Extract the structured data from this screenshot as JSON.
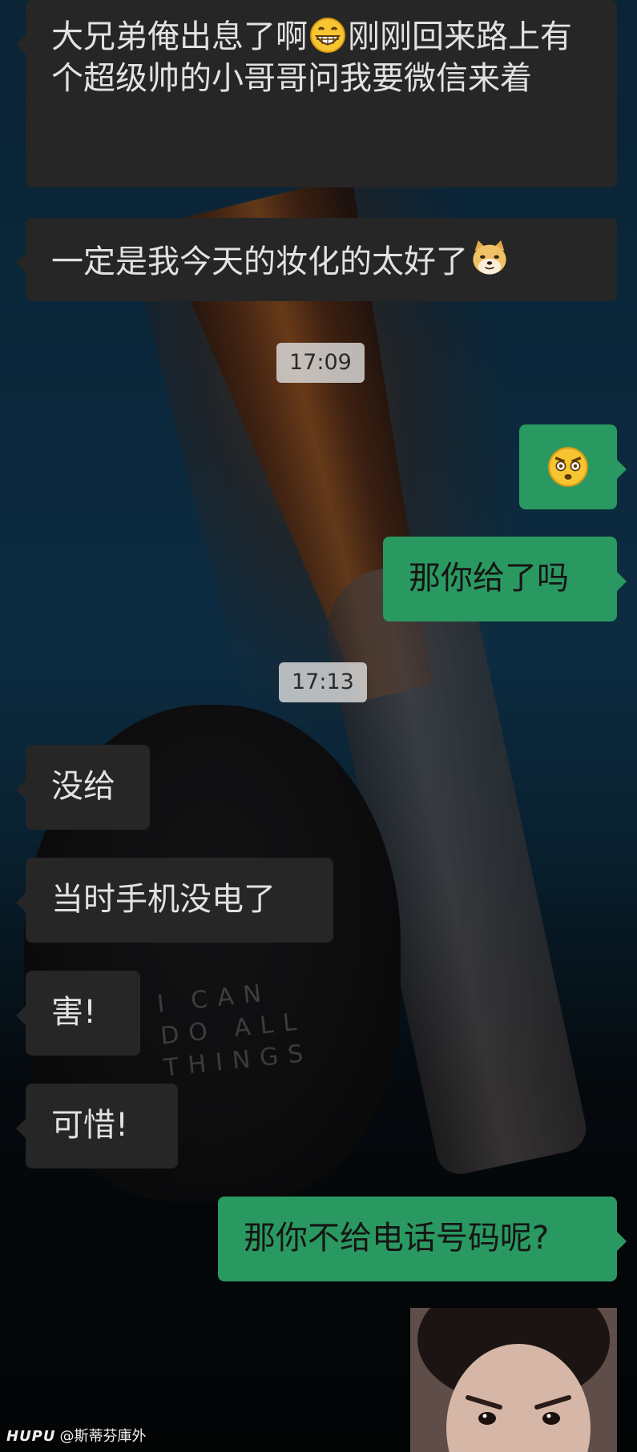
{
  "wallpaper": {
    "cap_text": "I CAN\nDO ALL\nTHINGS"
  },
  "messages": [
    {
      "side": "in",
      "text_a": "大兄弟俺出息了啊",
      "emoji_a": "grinning-face-icon",
      "text_b": "刚刚回来路上有个超级帅的小哥哥问我要微信来着"
    },
    {
      "side": "in",
      "text_a": "一定是我今天的妆化的太好了",
      "emoji_a": "doge-icon"
    },
    {
      "timestamp": "17:09"
    },
    {
      "side": "out",
      "emoji_a": "shocked-face-icon"
    },
    {
      "side": "out",
      "text_a": "那你给了吗"
    },
    {
      "timestamp": "17:13"
    },
    {
      "side": "in",
      "text_a": "没给"
    },
    {
      "side": "in",
      "text_a": "当时手机没电了"
    },
    {
      "side": "in",
      "text_a": "害!"
    },
    {
      "side": "in",
      "text_a": "可惜!"
    },
    {
      "side": "out",
      "text_a": "那你不给电话号码呢?"
    },
    {
      "side": "out",
      "sticker": "angry-child-sticker"
    }
  ],
  "colors": {
    "incoming_bubble": "#262626",
    "outgoing_bubble": "#2a9961",
    "timestamp_bg": "#dcdcdc"
  },
  "watermark": {
    "brand": "HUPU",
    "handle": "@斯蒂芬庫外"
  }
}
